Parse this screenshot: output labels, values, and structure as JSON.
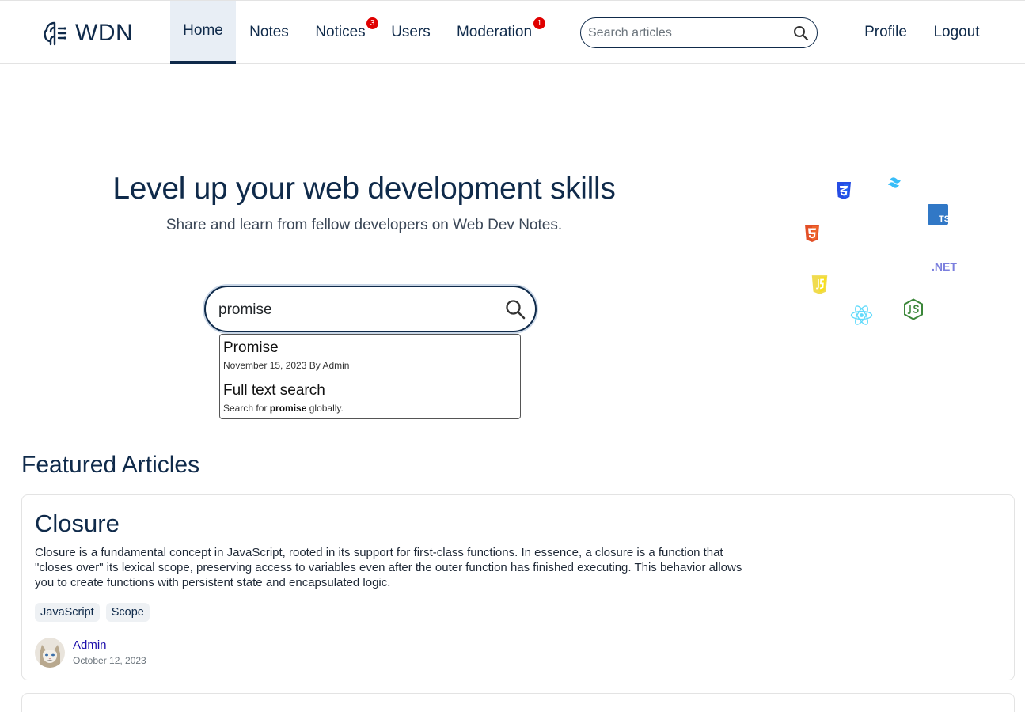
{
  "brand": {
    "name": "WDN",
    "logo_icon": "brain-code-icon"
  },
  "nav": {
    "items": [
      {
        "label": "Home",
        "active": true
      },
      {
        "label": "Notes"
      },
      {
        "label": "Notices",
        "badge": "3"
      },
      {
        "label": "Users"
      },
      {
        "label": "Moderation",
        "badge": "1"
      }
    ],
    "search_placeholder": "Search articles",
    "profile_label": "Profile",
    "logout_label": "Logout"
  },
  "hero": {
    "title": "Level up your web development skills",
    "subtitle": "Share and learn from fellow developers on Web Dev Notes.",
    "search_value": "promise",
    "suggestions": [
      {
        "title": "Promise",
        "date": "November 15, 2023",
        "by": "By",
        "author": "Admin"
      },
      {
        "title": "Full text search",
        "prefix": "Search for",
        "query": "promise",
        "suffix": "globally."
      }
    ],
    "tech_icons": [
      "css3-icon",
      "tailwind-icon",
      "typescript-icon",
      "html5-icon",
      "dotnet-icon",
      "javascript-icon",
      "nodejs-icon",
      "react-icon"
    ],
    "dotnet_label": ".NET",
    "ts_label": "TS"
  },
  "featured": {
    "title": "Featured Articles",
    "articles": [
      {
        "title": "Closure",
        "excerpt": "Closure is a fundamental concept in JavaScript, rooted in its support for first-class functions. In essence, a closure is a function that \"closes over\" its lexical scope, preserving access to variables even after the outer function has finished executing. This behavior allows you to create functions with persistent state and encapsulated logic.",
        "tags": [
          "JavaScript",
          "Scope"
        ],
        "author": "Admin",
        "date": "October 12, 2023"
      }
    ]
  },
  "colors": {
    "primary": "#0f2a4a",
    "badge": "#e00000",
    "link": "#1a0dab"
  }
}
